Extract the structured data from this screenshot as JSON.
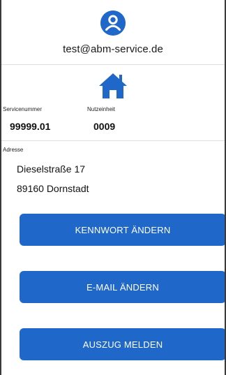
{
  "profile": {
    "icon": "user-circle-icon",
    "email": "test@abm-service.de"
  },
  "property": {
    "icon": "home-icon",
    "service_number_label": "Servicenummer",
    "service_number_value": "99999.01",
    "unit_label": "Nutzeinheit",
    "unit_value": "0009"
  },
  "address": {
    "label": "Adresse",
    "street": "Dieselstraße 17",
    "city": "89160 Dornstadt"
  },
  "actions": {
    "change_password": "KENNWORT ÄNDERN",
    "change_email": "E-MAIL ÄNDERN",
    "report_moveout": "AUSZUG MELDEN"
  },
  "colors": {
    "accent": "#1f67c9",
    "text": "#111111"
  }
}
